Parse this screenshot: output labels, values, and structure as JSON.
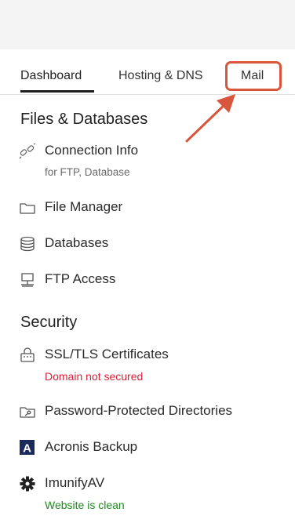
{
  "tabs": [
    {
      "label": "Dashboard",
      "active": true
    },
    {
      "label": "Hosting & DNS",
      "active": false
    },
    {
      "label": "Mail",
      "active": false,
      "highlighted": true
    }
  ],
  "colors": {
    "highlight": "#d9553b",
    "error": "#d6223a",
    "success": "#1f8a1f",
    "acronis": "#1a2a5c"
  },
  "files_section": {
    "title": "Files & Databases",
    "items": [
      {
        "label": "Connection Info",
        "sublabel": "for FTP, Database",
        "icon": "link-icon"
      },
      {
        "label": "File Manager",
        "icon": "folder-icon"
      },
      {
        "label": "Databases",
        "icon": "database-icon"
      },
      {
        "label": "FTP Access",
        "icon": "ftp-icon"
      }
    ]
  },
  "security_section": {
    "title": "Security",
    "items": [
      {
        "label": "SSL/TLS Certificates",
        "status": "Domain not secured",
        "icon": "lock-certificate-icon"
      },
      {
        "label": "Password-Protected Directories",
        "icon": "protected-folder-icon"
      },
      {
        "label": "Acronis Backup",
        "icon": "acronis-logo-icon",
        "logo_letter": "A"
      },
      {
        "label": "ImunifyAV",
        "status": "Website is clean",
        "icon": "imunify-gear-icon"
      }
    ]
  }
}
